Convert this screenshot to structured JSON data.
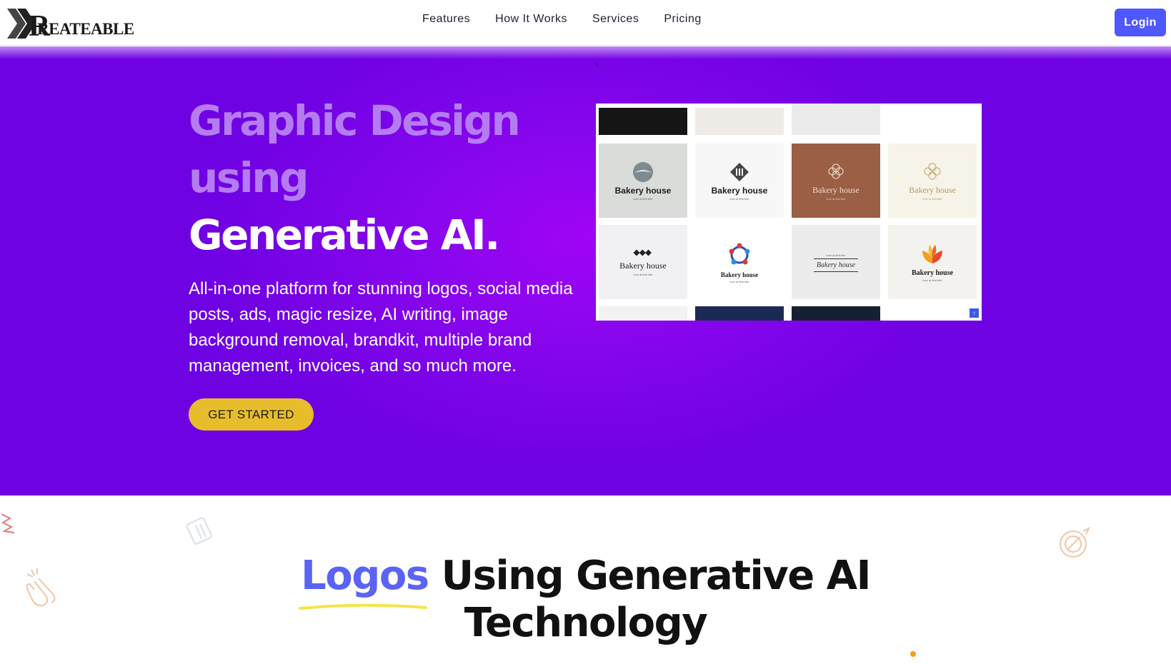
{
  "header": {
    "logo_text": "REATEABLE",
    "nav": [
      "Features",
      "How It Works",
      "Services",
      "Pricing"
    ],
    "login_label": "Login"
  },
  "hero": {
    "title_line1": "Graphic Design",
    "title_line2": "using",
    "title_line3": "Generative AI.",
    "description": "All-in-one platform for stunning logos, social media posts, ads, magic resize, AI writing, image background removal, brandkit, multiple brand management, invoices, and so much more.",
    "cta_label": "GET STARTED"
  },
  "preview": {
    "tiles": [
      {
        "brand": "Bakery house",
        "tagline": "love at first bite",
        "bg": "#d9dcd8"
      },
      {
        "brand": "Bakery house",
        "tagline": "love at first bite",
        "bg": "#f7f7f7"
      },
      {
        "brand": "Bakery house",
        "tagline": "love at first bite",
        "bg": "#9a5f45"
      },
      {
        "brand": "Bakery house",
        "tagline": "love at first bite",
        "bg": "#f6f3e8"
      },
      {
        "brand": "Bakery house",
        "tagline": "love at first bite",
        "bg": "#f1f1f4"
      },
      {
        "brand": "Bakery house",
        "tagline": "love at first bite",
        "bg": "#ffffff"
      },
      {
        "brand": "Bakery house",
        "tagline": "love at first bite",
        "bg": "#ececec"
      },
      {
        "brand": "Bakery house",
        "tagline": "love at first bite",
        "bg": "#f3f2ee"
      }
    ]
  },
  "section": {
    "title_highlight": "Logos",
    "title_rest": " Using Generative AI",
    "title_line2": "Technology"
  },
  "colors": {
    "accent": "#4f57ff",
    "hero_purple": "#7a05e8",
    "cta_yellow": "#e8bd2b",
    "highlight_blue": "#5b63f5"
  }
}
